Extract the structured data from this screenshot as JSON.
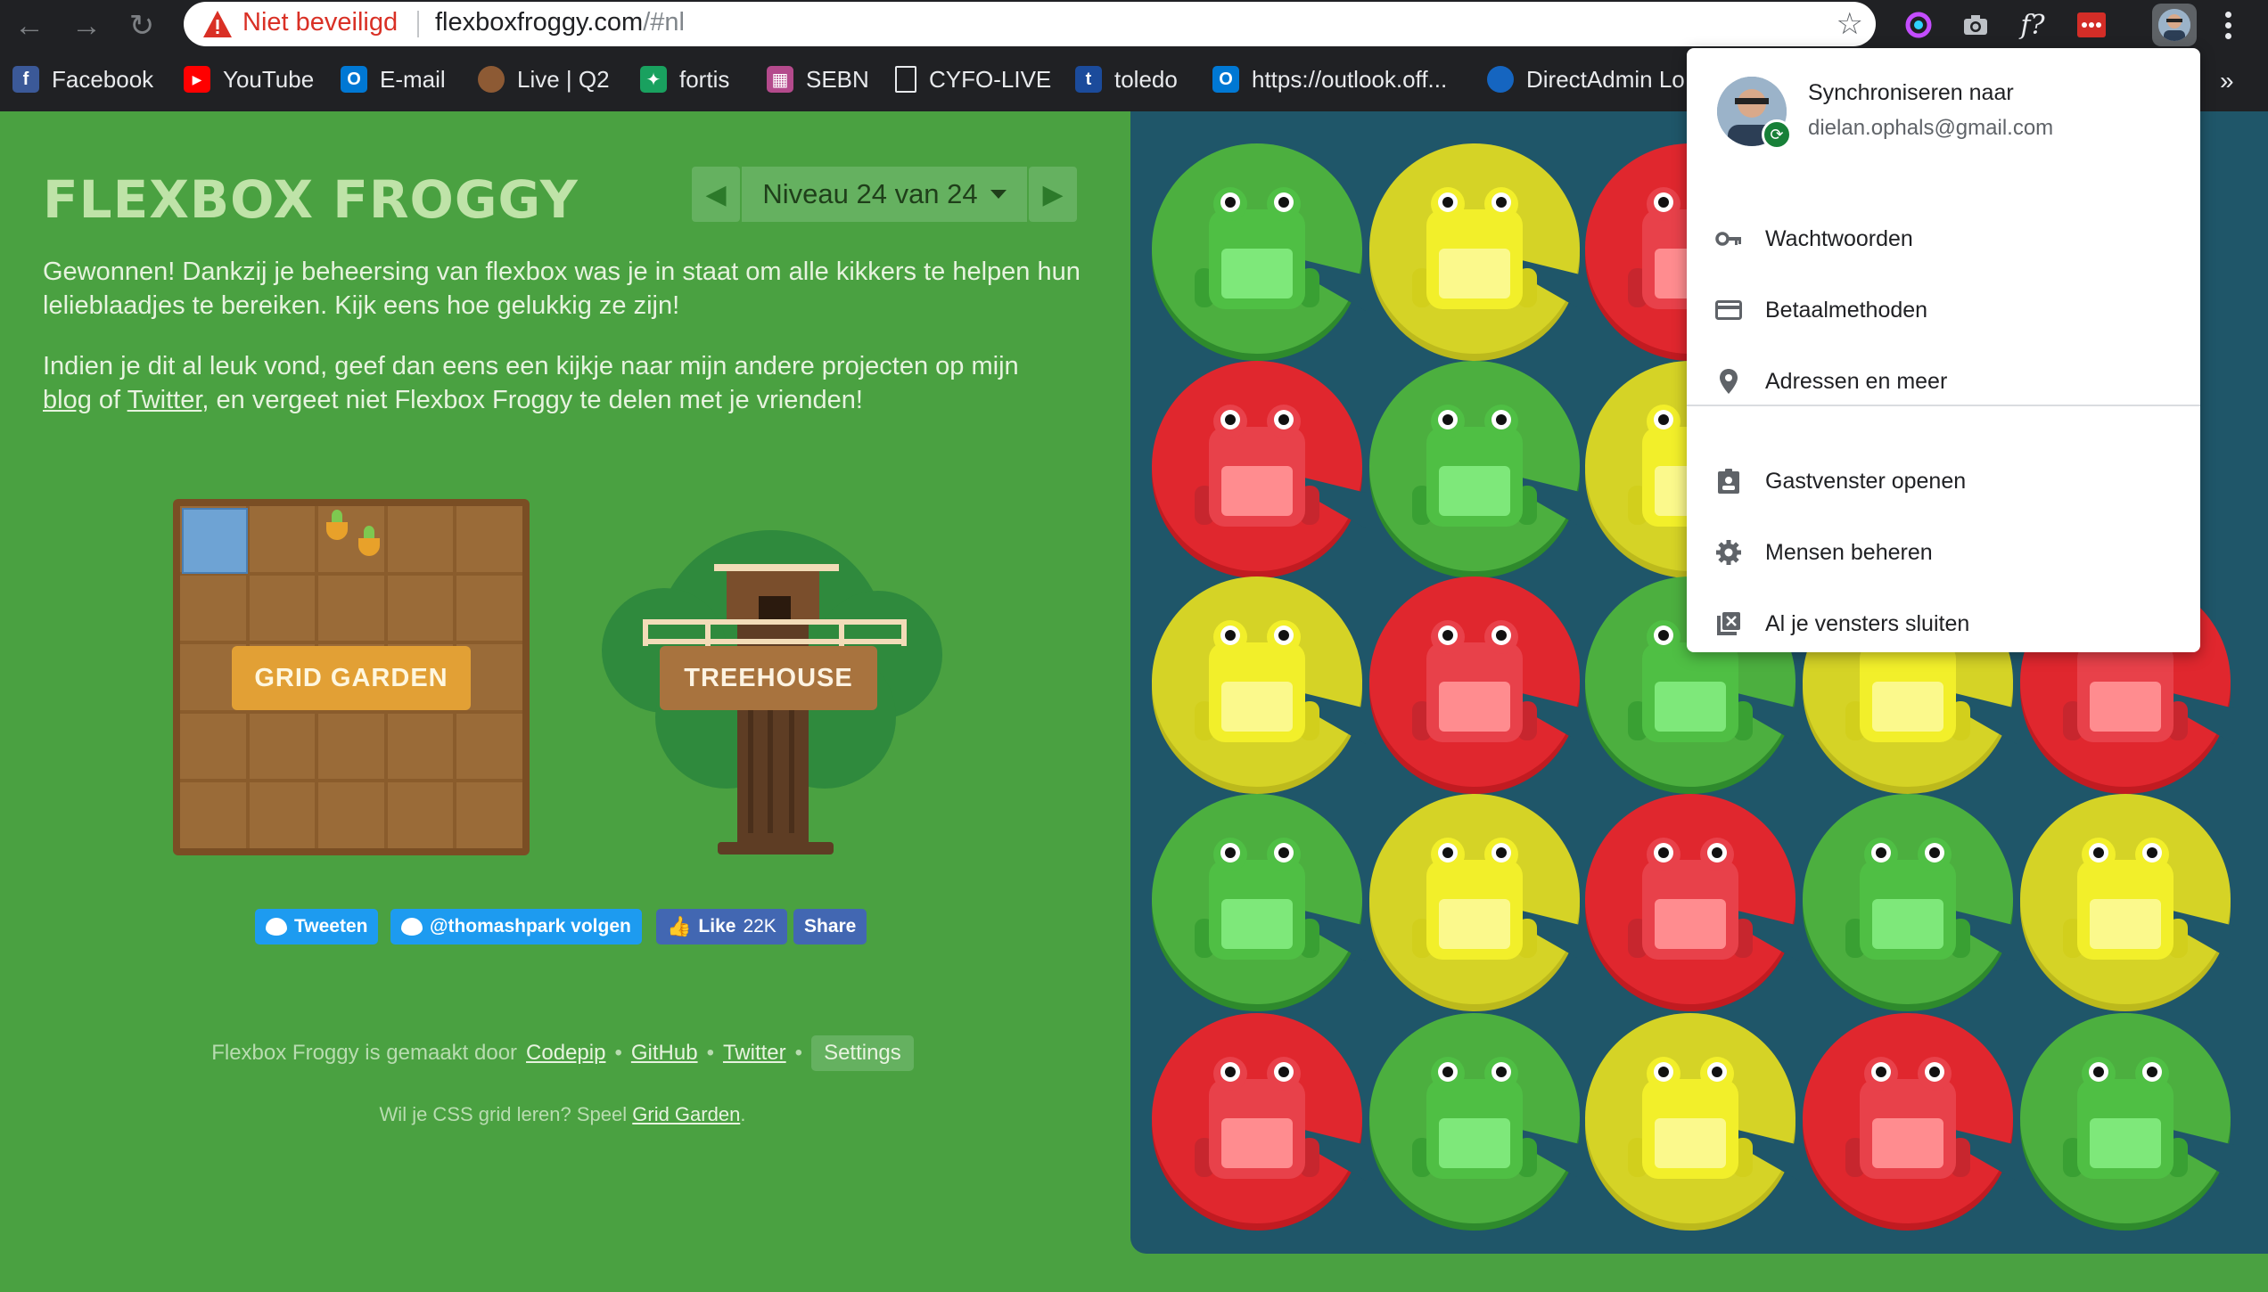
{
  "browser": {
    "security_label": "Niet beveiligd",
    "url_host": "flexboxfroggy.com",
    "url_path": "/#nl",
    "extensions": [
      {
        "icon": "color-picker-icon"
      },
      {
        "icon": "camera-icon"
      },
      {
        "label": "f?"
      },
      {
        "icon": "lastpass-icon"
      }
    ]
  },
  "bookmarks": [
    {
      "label": "Facebook",
      "icon": "facebook-icon",
      "color": "#3b5998",
      "glyph": "f"
    },
    {
      "label": "YouTube",
      "icon": "youtube-icon",
      "color": "#ff0000",
      "glyph": "▶"
    },
    {
      "label": "E-mail",
      "icon": "outlook-icon",
      "color": "#0078d4",
      "glyph": "O"
    },
    {
      "label": "Live | Q2",
      "icon": "cookie-icon",
      "color": "#8d5a34",
      "glyph": "●"
    },
    {
      "label": "fortis",
      "icon": "fortis-icon",
      "color": "#19a15f",
      "glyph": "✦"
    },
    {
      "label": "SEBN",
      "icon": "sebn-icon",
      "color": "#b44a8c",
      "glyph": "▦"
    },
    {
      "label": "CYFO-LIVE",
      "icon": "page-icon",
      "color": "#202124",
      "glyph": "▯"
    },
    {
      "label": "toledo",
      "icon": "toledo-icon",
      "color": "#1b4b9b",
      "glyph": "t"
    },
    {
      "label": "https://outlook.off...",
      "icon": "outlook-icon",
      "color": "#0078d4",
      "glyph": "O"
    },
    {
      "label": "DirectAdmin Lo",
      "icon": "directadmin-icon",
      "color": "#1565c0",
      "glyph": "●"
    }
  ],
  "bookmarks_more": "»",
  "game": {
    "title": "FLEXBOX FROGGY",
    "level_label": "Niveau 24 van 24",
    "paragraph1": "Gewonnen! Dankzij je beheersing van flexbox was je in staat om alle kikkers te helpen hun lelieblaadjes te bereiken. Kijk eens hoe gelukkig ze zijn!",
    "paragraph2_start": "Indien je dit al leuk vond, geef dan eens een kijkje naar mijn andere projecten op mijn",
    "paragraph2_link1": "blog",
    "paragraph2_mid": " of ",
    "paragraph2_link2": "Twitter",
    "paragraph2_end": ", en vergeet niet Flexbox Froggy te delen met je vrienden!",
    "grid_garden_label": "GRID GARDEN",
    "treehouse_label": "TREEHOUSE",
    "social": {
      "tweet": "Tweeten",
      "follow": "@thomashpark volgen",
      "like": "Like",
      "like_count": "22K",
      "share": "Share"
    },
    "footer": {
      "made_by": "Flexbox Froggy is gemaakt door",
      "codepip": "Codepip",
      "github": "GitHub",
      "twitter": "Twitter",
      "bullet": "•",
      "settings": "Settings",
      "grid_prompt": "Wil je CSS grid leren? Speel",
      "grid_link": "Grid Garden",
      "period": "."
    }
  },
  "pond": {
    "colors": {
      "green": "#4caf3f",
      "green_dark": "#2e8a2c",
      "red": "#e0272e",
      "red_dark": "#c11b21",
      "yellow": "#d5d326",
      "yellow_dark": "#bcb91c",
      "water": "#1f5669"
    },
    "rows": [
      [
        "green",
        "yellow",
        "red",
        "yellow"
      ],
      [
        "red",
        "green",
        "yellow",
        "green"
      ],
      [
        "yellow",
        "red",
        "green",
        "yellow",
        "red"
      ],
      [
        "green",
        "yellow",
        "red",
        "green",
        "yellow"
      ],
      [
        "red",
        "green",
        "yellow",
        "red",
        "green"
      ]
    ]
  },
  "profile_menu": {
    "sync_label": "Synchroniseren naar",
    "email": "dielan.ophals@gmail.com",
    "items": [
      {
        "label": "Wachtwoorden",
        "icon": "key-icon"
      },
      {
        "label": "Betaalmethoden",
        "icon": "credit-card-icon"
      },
      {
        "label": "Adressen en meer",
        "icon": "location-pin-icon"
      },
      {
        "label": "Gastvenster openen",
        "icon": "guest-badge-icon"
      },
      {
        "label": "Mensen beheren",
        "icon": "gear-icon"
      },
      {
        "label": "Al je vensters sluiten",
        "icon": "close-windows-icon"
      }
    ]
  }
}
